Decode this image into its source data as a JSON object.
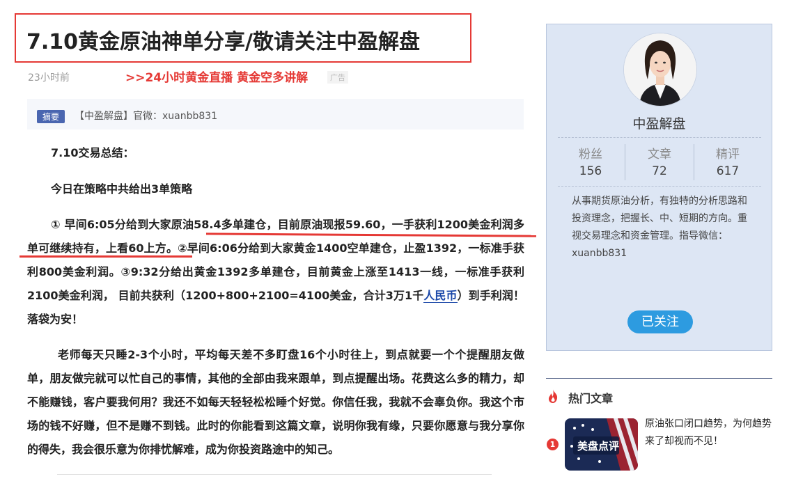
{
  "article": {
    "title": "7.10黄金原油神单分享/敬请关注中盈解盘",
    "time": "23小时前",
    "promo": ">>24小时黄金直播 黄金空多讲解",
    "ad_label": "广告",
    "summary_tag": "摘要",
    "summary_text": "【中盈解盘】官微：xuanbb831",
    "heading1": "7.10交易总结：",
    "heading2": "今日在策略中共给出3单策略",
    "para1_a": "① 早间6:05分给到大家原油58.4多单建仓，目前原油现报59.60，一手获利1200美金利润多单可继续持有，上看60上方。②早间6:06分给到大家黄金1400空单建仓，止盈1392，一标准手获利800美金利润。③9:32分给出黄金1392多单建仓，目前黄金上涨至1413一线，一标准手获利2100美金利润， 目前共获利（1200+800+2100=4100美金，合计3万1千",
    "para1_link": "人民币",
    "para1_b": "）到手利润！落袋为安！",
    "para2": "老师每天只睡2-3个小时，平均每天差不多盯盘16个小时往上，到点就要一个个提醒朋友做单，朋友做完就可以忙自己的事情，其他的全部由我来跟单，到点提醒出场。花费这么多的精力，却不能赚钱，客户要我何用？我还不如每天轻轻松松睡个好觉。你信任我，我就不会辜负你。我这个市场的钱不好赚，但不是赚不到钱。此时的你能看到这篇文章，说明你我有缘，只要你愿意与我分享你的得失，我会很乐意为你排忧解难，成为你投资路途中的知己。"
  },
  "profile": {
    "name": "中盈解盘",
    "stats": [
      {
        "label": "粉丝",
        "value": "156"
      },
      {
        "label": "文章",
        "value": "72"
      },
      {
        "label": "精评",
        "value": "617"
      }
    ],
    "bio": "从事期货原油分析，有独特的分析思路和投资理念，把握长、中、短期的方向。重视交易理念和资金管理。指导微信：xuanbb831",
    "follow_label": "已关注"
  },
  "hot": {
    "title": "热门文章",
    "items": [
      {
        "num": "1",
        "title": "原油张口闭口趋势，为何趋势来了却视而不见！",
        "thumb_text": "美盘点评"
      }
    ]
  },
  "colors": {
    "accent_red": "#e53935",
    "brand_blue": "#2d9be0",
    "panel_bg": "#dde6f4"
  }
}
